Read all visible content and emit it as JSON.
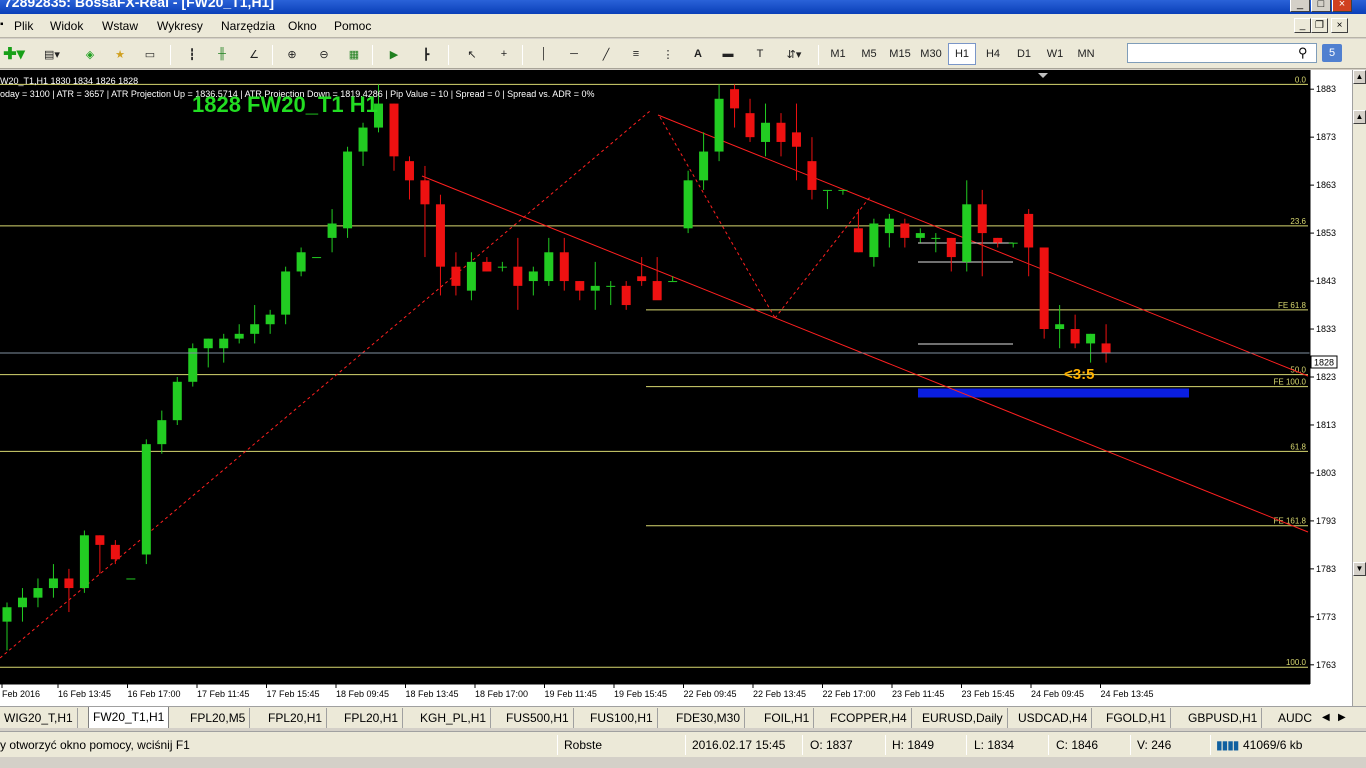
{
  "window": {
    "title": "72892835: BossaFX-Real - [FW20_T1,H1]"
  },
  "menu": {
    "items": [
      "Plik",
      "Widok",
      "Wstaw",
      "Wykresy",
      "Narzędzia",
      "Okno",
      "Pomoc"
    ]
  },
  "toolbar": {
    "timeframes": [
      "M1",
      "M5",
      "M15",
      "M30",
      "H1",
      "H4",
      "D1",
      "W1",
      "MN"
    ],
    "active_timeframe": "H1",
    "search_value": "",
    "help_label": "5"
  },
  "chart": {
    "info_line": "W20_T1,H1  1830 1834 1826 1828",
    "indicator_line": "oday = 3100   |   ATR = 3657   |   ATR Projection Up = 1836.5714   |   ATR Projection Down = 1819.4286   |   Pip Value = 10   |   Spread = 0   |   Spread vs. ADR = 0%",
    "big_label": "1828 FW20_T1 H1",
    "annotation": "<3:5",
    "current_price": "1828",
    "colors": {
      "background": "#000000",
      "bull": "#22cc22",
      "bear": "#ee1111",
      "fib": "#d8d870",
      "channel": "#ff2020",
      "zone": "#0a1ee0",
      "big_label": "#22dd22",
      "annotation": "#ffb000"
    },
    "price_axis": [
      "1883",
      "1873",
      "1863",
      "1853",
      "1843",
      "1833",
      "1823",
      "1813",
      "1803",
      "1793",
      "1783",
      "1773",
      "1763"
    ],
    "time_axis": [
      "Feb 2016",
      "16 Feb 13:45",
      "16 Feb 17:00",
      "17 Feb 11:45",
      "17 Feb 15:45",
      "18 Feb 09:45",
      "18 Feb 13:45",
      "18 Feb 17:00",
      "19 Feb 11:45",
      "19 Feb 15:45",
      "22 Feb 09:45",
      "22 Feb 13:45",
      "22 Feb 17:00",
      "23 Feb 11:45",
      "23 Feb 15:45",
      "24 Feb 09:45",
      "24 Feb 13:45"
    ],
    "fib_labels": [
      {
        "text": "0.0",
        "price": 1884
      },
      {
        "text": "23.6",
        "price": 1854.5
      },
      {
        "text": "FE 61.8",
        "price": 1837
      },
      {
        "text": "50.0",
        "price": 1823.5
      },
      {
        "text": "FE 100.0",
        "price": 1821
      },
      {
        "text": "61.8",
        "price": 1807.5
      },
      {
        "text": "FE 161.8",
        "price": 1792
      },
      {
        "text": "100.0",
        "price": 1762.5
      }
    ]
  },
  "chart_data": {
    "type": "candlestick",
    "price_range": [
      1759,
      1887
    ],
    "candles": [
      [
        1772,
        1776,
        1766,
        1775
      ],
      [
        1775,
        1779,
        1772,
        1777
      ],
      [
        1777,
        1781,
        1775,
        1779
      ],
      [
        1779,
        1784,
        1777,
        1781
      ],
      [
        1781,
        1783,
        1774,
        1779
      ],
      [
        1779,
        1791,
        1778,
        1790
      ],
      [
        1790,
        1790,
        1782,
        1788
      ],
      [
        1788,
        1789,
        1784,
        1785
      ],
      [
        1781,
        1781,
        1781,
        1781
      ],
      [
        1786,
        1810,
        1784,
        1809
      ],
      [
        1809,
        1816,
        1807,
        1814
      ],
      [
        1814,
        1823,
        1813,
        1822
      ],
      [
        1822,
        1830,
        1821,
        1829
      ],
      [
        1829,
        1831,
        1825,
        1831
      ],
      [
        1829,
        1832,
        1826,
        1831
      ],
      [
        1831,
        1834,
        1830,
        1832
      ],
      [
        1832,
        1838,
        1830,
        1834
      ],
      [
        1834,
        1837,
        1832,
        1836
      ],
      [
        1836,
        1846,
        1834,
        1845
      ],
      [
        1845,
        1850,
        1844,
        1849
      ],
      [
        1848,
        1848,
        1848,
        1848
      ],
      [
        1852,
        1858,
        1849,
        1855
      ],
      [
        1854,
        1871,
        1852,
        1870
      ],
      [
        1870,
        1876,
        1867,
        1875
      ],
      [
        1875,
        1884,
        1874,
        1880
      ],
      [
        1880,
        1880,
        1866,
        1869
      ],
      [
        1868,
        1869,
        1860,
        1864
      ],
      [
        1864,
        1867,
        1848,
        1859
      ],
      [
        1859,
        1861,
        1840,
        1846
      ],
      [
        1846,
        1849,
        1840,
        1842
      ],
      [
        1841,
        1849,
        1839,
        1847
      ],
      [
        1847,
        1848,
        1845,
        1845
      ],
      [
        1846,
        1847,
        1845,
        1846
      ],
      [
        1846,
        1852,
        1837,
        1842
      ],
      [
        1843,
        1846,
        1840,
        1845
      ],
      [
        1843,
        1852,
        1842,
        1849
      ],
      [
        1849,
        1852,
        1841,
        1843
      ],
      [
        1843,
        1843,
        1839,
        1841
      ],
      [
        1841,
        1847,
        1837,
        1842
      ],
      [
        1842,
        1843,
        1838,
        1842
      ],
      [
        1842,
        1843,
        1837,
        1838
      ],
      [
        1844,
        1848,
        1842,
        1843
      ],
      [
        1843,
        1848,
        1840,
        1839
      ],
      [
        1843,
        1844,
        1843,
        1843
      ],
      [
        1854,
        1866,
        1853,
        1864
      ],
      [
        1864,
        1874,
        1862,
        1870
      ],
      [
        1870,
        1884,
        1868,
        1881
      ],
      [
        1883,
        1884,
        1875,
        1879
      ],
      [
        1878,
        1881,
        1872,
        1873
      ],
      [
        1872,
        1880,
        1869,
        1876
      ],
      [
        1876,
        1878,
        1869,
        1872
      ],
      [
        1874,
        1880,
        1864,
        1871
      ],
      [
        1868,
        1873,
        1860,
        1862
      ],
      [
        1862,
        1862,
        1858,
        1862
      ],
      [
        1862,
        1862,
        1861,
        1862
      ],
      [
        1854,
        1858,
        1849,
        1849
      ],
      [
        1848,
        1856,
        1846,
        1855
      ],
      [
        1853,
        1857,
        1850,
        1856
      ],
      [
        1855,
        1856,
        1850,
        1852
      ],
      [
        1852,
        1854,
        1851,
        1853
      ],
      [
        1852,
        1853,
        1849,
        1852
      ],
      [
        1852,
        1852,
        1845,
        1848
      ],
      [
        1847,
        1864,
        1845,
        1859
      ],
      [
        1859,
        1862,
        1844,
        1853
      ],
      [
        1852,
        1852,
        1850,
        1851
      ],
      [
        1851,
        1851,
        1850,
        1851
      ],
      [
        1857,
        1858,
        1844,
        1850
      ],
      [
        1850,
        1850,
        1831,
        1833
      ],
      [
        1833,
        1838,
        1829,
        1834
      ],
      [
        1833,
        1836,
        1829,
        1830
      ],
      [
        1830,
        1832,
        1826,
        1832
      ],
      [
        1830,
        1834,
        1826,
        1828
      ]
    ]
  },
  "tabs": {
    "items": [
      "WIG20_T,H1",
      "FW20_T1,H1",
      "FPL20,M5",
      "FPL20,H1",
      "FPL20,H1",
      "KGH_PL,H1",
      "FUS500,H1",
      "FUS100,H1",
      "FDE30,M30",
      "FOIL,H1",
      "FCOPPER,H4",
      "EURUSD,Daily",
      "USDCAD,H4",
      "FGOLD,H1",
      "GBPUSD,H1",
      "AUDC"
    ],
    "active": "FW20_T1,H1"
  },
  "status": {
    "help_text": "y otworzyć okno pomocy, wciśnij F1",
    "profile": "Robste",
    "datetime": "2016.02.17 15:45",
    "open": "O: 1837",
    "high": "H: 1849",
    "low": "L: 1834",
    "close": "C: 1846",
    "volume": "V: 246",
    "traffic": "41069/6 kb"
  }
}
